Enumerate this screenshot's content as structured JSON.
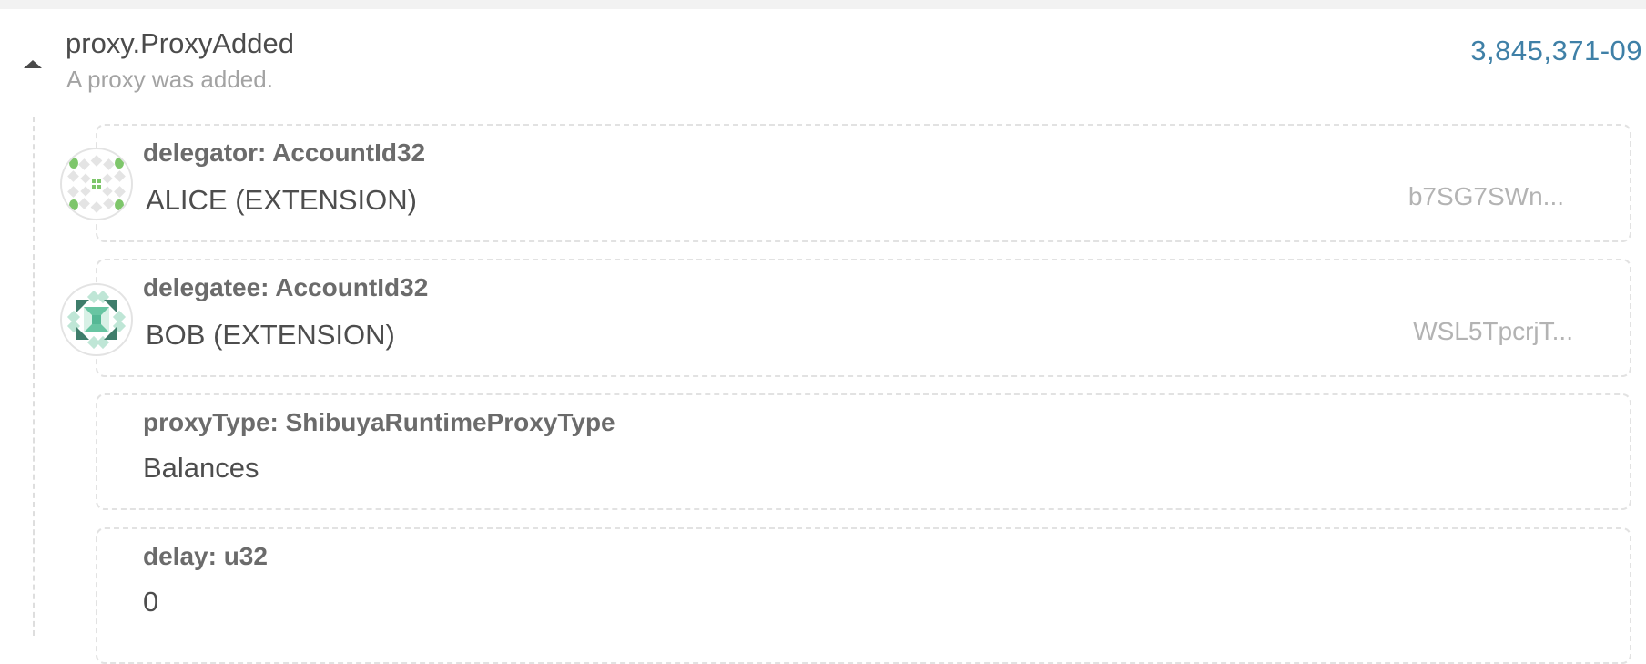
{
  "event": {
    "title": "proxy.ProxyAdded",
    "description": "A proxy was added.",
    "link": "3,845,371-09",
    "toggle_icon": "chevron-up-icon",
    "colors": {
      "link": "#3f80a7",
      "title": "#4b4b4b",
      "description": "#a3a3a3"
    }
  },
  "params": [
    {
      "label": "delegator: AccountId32",
      "value": "ALICE (EXTENSION)",
      "address": "b7SG7SWn...",
      "avatar_icon": "identicon-alice-icon"
    },
    {
      "label": "delegatee: AccountId32",
      "value": "BOB (EXTENSION)",
      "address": "WSL5TpcrjT...",
      "avatar_icon": "identicon-bob-icon"
    },
    {
      "label": "proxyType: ShibuyaRuntimeProxyType",
      "value": "Balances"
    },
    {
      "label": "delay: u32",
      "value": "0"
    }
  ]
}
